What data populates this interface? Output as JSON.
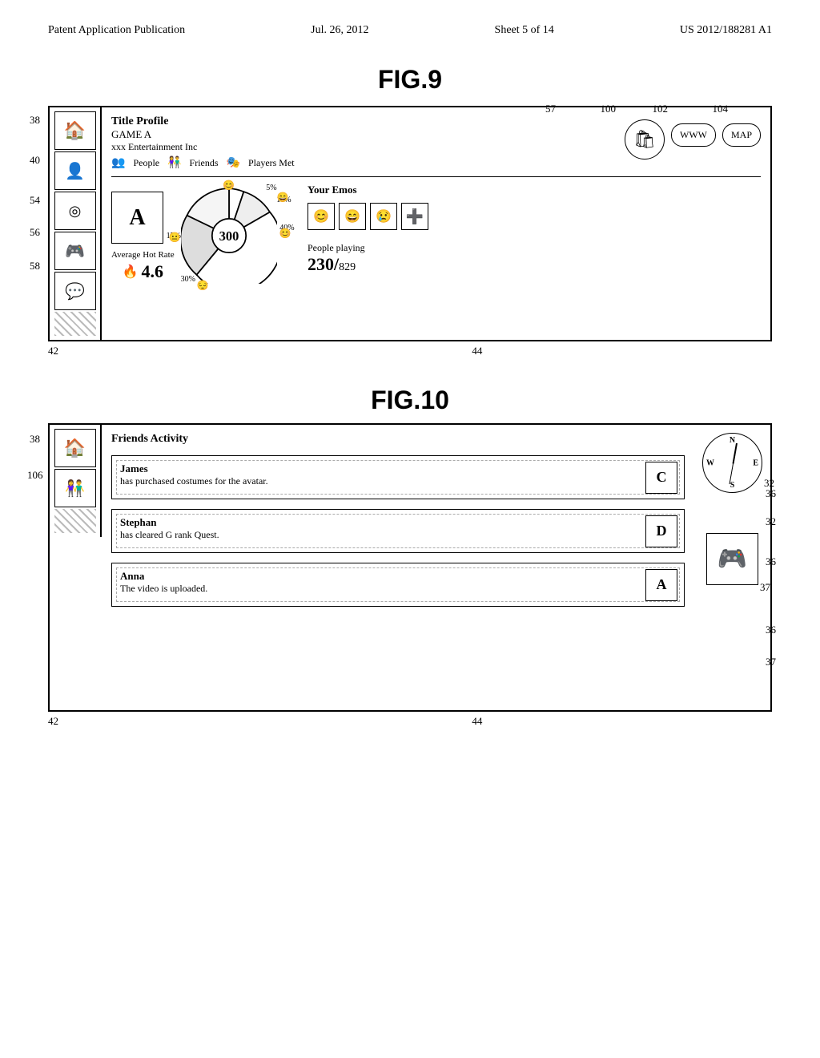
{
  "header": {
    "left": "Patent Application Publication",
    "center": "Jul. 26, 2012",
    "sheet": "Sheet 5 of 14",
    "right": "US 2012/188281 A1"
  },
  "fig9": {
    "title": "FIG.9",
    "title_profile": "Title Profile",
    "game_name": "GAME  A",
    "company": "xxx  Entertainment Inc",
    "people_label": "People",
    "friends_label": "Friends",
    "players_met_label": "Players Met",
    "www_label": "WWW",
    "map_label": "MAP",
    "chart_letter": "A",
    "percentages": [
      "10%",
      "5%",
      "40%",
      "30%",
      "15%"
    ],
    "center_number": "300",
    "avg_hot_rate_label": "Average Hot Rate",
    "hot_rate_value": "4.6",
    "your_emos_label": "Your Emos",
    "people_playing_label": "People playing",
    "people_playing_value": "230",
    "people_playing_total": "829",
    "ref_numbers": {
      "n38": "38",
      "n40": "40",
      "n54": "54",
      "n56": "56",
      "n58": "58",
      "n57": "57",
      "n100": "100",
      "n102": "102",
      "n104": "104",
      "n42": "42",
      "n44": "44"
    }
  },
  "fig10": {
    "title": "FIG.10",
    "friends_activity_label": "Friends Activity",
    "friend1": {
      "name": "James",
      "action": "has purchased costumes for the avatar.",
      "avatar_letter": "C"
    },
    "friend2": {
      "name": "Stephan",
      "action": "has cleared G rank Quest.",
      "avatar_letter": "D"
    },
    "friend3": {
      "name": "Anna",
      "action": "The video is uploaded.",
      "avatar_letter": "A"
    },
    "compass": {
      "n": "N",
      "s": "S",
      "e": "E",
      "w": "W"
    },
    "ref_numbers": {
      "n38": "38",
      "n106": "106",
      "n36a": "36",
      "n36b": "36",
      "n36c": "36",
      "n32": "32",
      "n37": "37",
      "n42": "42",
      "n44": "44"
    }
  }
}
